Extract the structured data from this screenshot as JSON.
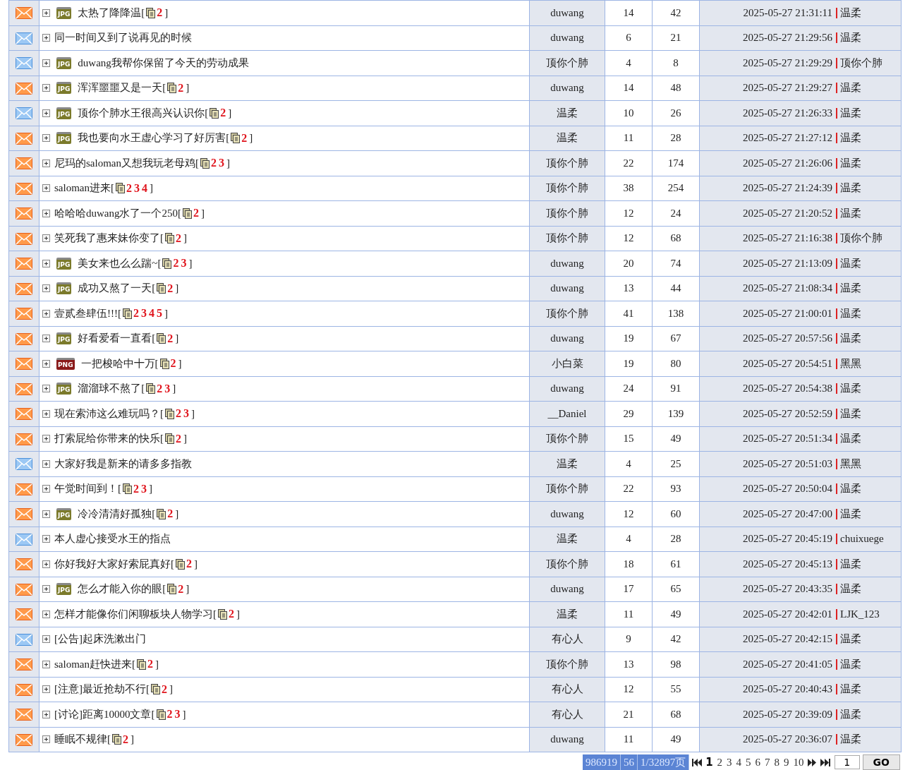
{
  "topics": [
    {
      "hot": true,
      "file": {
        "label": "JPG",
        "color": "#7b7a2a"
      },
      "title": "太热了降降温",
      "pages": {
        "open": "[",
        "links": [
          "2"
        ],
        "close": "]"
      },
      "author": "duwang",
      "replies": "14",
      "views": "42",
      "last_time": "2025-05-27 21:31:11",
      "last_user": "温柔"
    },
    {
      "hot": false,
      "title": "同一时间又到了说再见的时候",
      "author": "duwang",
      "replies": "6",
      "views": "21",
      "last_time": "2025-05-27 21:29:56",
      "last_user": "温柔"
    },
    {
      "hot": false,
      "file": {
        "label": "JPG",
        "color": "#7b7a2a"
      },
      "title": "duwang我帮你保留了今天的劳动成果",
      "author": "顶你个肺",
      "replies": "4",
      "views": "8",
      "last_time": "2025-05-27 21:29:29",
      "last_user": "顶你个肺"
    },
    {
      "hot": true,
      "file": {
        "label": "JPG",
        "color": "#7b7a2a"
      },
      "title": "浑浑噩噩又是一天",
      "pages": {
        "open": "[",
        "links": [
          "2"
        ],
        "close": "]"
      },
      "author": "duwang",
      "replies": "14",
      "views": "48",
      "last_time": "2025-05-27 21:29:27",
      "last_user": "温柔"
    },
    {
      "hot": false,
      "file": {
        "label": "JPG",
        "color": "#7b7a2a"
      },
      "title": "顶你个肺水王很高兴认识你",
      "pages": {
        "open": "[",
        "links": [
          "2"
        ],
        "close": "]"
      },
      "author": "温柔",
      "replies": "10",
      "views": "26",
      "last_time": "2025-05-27 21:26:33",
      "last_user": "温柔"
    },
    {
      "hot": true,
      "file": {
        "label": "JPG",
        "color": "#7b7a2a"
      },
      "title": "我也要向水王虚心学习了好厉害",
      "pages": {
        "open": "[",
        "links": [
          "2"
        ],
        "close": "]"
      },
      "author": "温柔",
      "replies": "11",
      "views": "28",
      "last_time": "2025-05-27 21:27:12",
      "last_user": "温柔"
    },
    {
      "hot": true,
      "title": "尼玛的saloman又想我玩老母鸡",
      "pages": {
        "open": "[",
        "links": [
          "2",
          "3"
        ],
        "close": "]"
      },
      "author": "顶你个肺",
      "replies": "22",
      "views": "174",
      "last_time": "2025-05-27 21:26:06",
      "last_user": "温柔"
    },
    {
      "hot": true,
      "title": "saloman进来",
      "pages": {
        "open": "[",
        "links": [
          "2",
          "3",
          "4"
        ],
        "close": "]"
      },
      "author": "顶你个肺",
      "replies": "38",
      "views": "254",
      "last_time": "2025-05-27 21:24:39",
      "last_user": "温柔"
    },
    {
      "hot": true,
      "title": "哈哈哈duwang水了一个250",
      "pages": {
        "open": "[",
        "links": [
          "2"
        ],
        "close": "]"
      },
      "author": "顶你个肺",
      "replies": "12",
      "views": "24",
      "last_time": "2025-05-27 21:20:52",
      "last_user": "温柔"
    },
    {
      "hot": true,
      "title": "笑死我了惠来妹你变了",
      "pages": {
        "open": "[",
        "links": [
          "2"
        ],
        "close": "]"
      },
      "author": "顶你个肺",
      "replies": "12",
      "views": "68",
      "last_time": "2025-05-27 21:16:38",
      "last_user": "顶你个肺"
    },
    {
      "hot": true,
      "file": {
        "label": "JPG",
        "color": "#7b7a2a"
      },
      "title": "美女来也么么踹~",
      "pages": {
        "open": "[",
        "links": [
          "2",
          "3"
        ],
        "close": "]"
      },
      "author": "duwang",
      "replies": "20",
      "views": "74",
      "last_time": "2025-05-27 21:13:09",
      "last_user": "温柔"
    },
    {
      "hot": true,
      "file": {
        "label": "JPG",
        "color": "#7b7a2a"
      },
      "title": "成功又熬了一天",
      "pages": {
        "open": "[",
        "links": [
          "2"
        ],
        "close": "]"
      },
      "author": "duwang",
      "replies": "13",
      "views": "44",
      "last_time": "2025-05-27 21:08:34",
      "last_user": "温柔"
    },
    {
      "hot": true,
      "title": "壹贰叁肆伍!!!",
      "pages": {
        "open": "[",
        "links": [
          "2",
          "3",
          "4",
          "5"
        ],
        "close": "]"
      },
      "author": "顶你个肺",
      "replies": "41",
      "views": "138",
      "last_time": "2025-05-27 21:00:01",
      "last_user": "温柔"
    },
    {
      "hot": true,
      "file": {
        "label": "JPG",
        "color": "#7b7a2a"
      },
      "title": "好看爱看一直看",
      "pages": {
        "open": "[",
        "links": [
          "2"
        ],
        "close": "]"
      },
      "author": "duwang",
      "replies": "19",
      "views": "67",
      "last_time": "2025-05-27 20:57:56",
      "last_user": "温柔"
    },
    {
      "hot": true,
      "file": {
        "label": "PNG",
        "color": "#8a1a1a"
      },
      "title": "一把梭哈中十万",
      "pages": {
        "open": "[",
        "links": [
          "2"
        ],
        "close": "]"
      },
      "author": "小白菜",
      "replies": "19",
      "views": "80",
      "last_time": "2025-05-27 20:54:51",
      "last_user": "黑黑"
    },
    {
      "hot": true,
      "file": {
        "label": "JPG",
        "color": "#7b7a2a"
      },
      "title": "溜溜球不熬了",
      "pages": {
        "open": "[",
        "links": [
          "2",
          "3"
        ],
        "close": "]"
      },
      "author": "duwang",
      "replies": "24",
      "views": "91",
      "last_time": "2025-05-27 20:54:38",
      "last_user": "温柔"
    },
    {
      "hot": true,
      "title": "现在索沛这么难玩吗？",
      "pages": {
        "open": "[",
        "links": [
          "2",
          "3"
        ],
        "close": "]"
      },
      "author": "__Daniel",
      "replies": "29",
      "views": "139",
      "last_time": "2025-05-27 20:52:59",
      "last_user": "温柔"
    },
    {
      "hot": true,
      "title": "打索屁给你带来的快乐",
      "pages": {
        "open": "[",
        "links": [
          "2"
        ],
        "close": "]"
      },
      "author": "顶你个肺",
      "replies": "15",
      "views": "49",
      "last_time": "2025-05-27 20:51:34",
      "last_user": "温柔"
    },
    {
      "hot": false,
      "title": "大家好我是新来的请多多指教",
      "author": "温柔",
      "replies": "4",
      "views": "25",
      "last_time": "2025-05-27 20:51:03",
      "last_user": "黑黑"
    },
    {
      "hot": true,
      "title": "午觉时间到！",
      "pages": {
        "open": "[",
        "links": [
          "2",
          "3"
        ],
        "close": "]"
      },
      "author": "顶你个肺",
      "replies": "22",
      "views": "93",
      "last_time": "2025-05-27 20:50:04",
      "last_user": "温柔"
    },
    {
      "hot": true,
      "file": {
        "label": "JPG",
        "color": "#7b7a2a"
      },
      "title": "冷冷清清好孤独",
      "pages": {
        "open": "[",
        "links": [
          "2"
        ],
        "close": "]"
      },
      "author": "duwang",
      "replies": "12",
      "views": "60",
      "last_time": "2025-05-27 20:47:00",
      "last_user": "温柔"
    },
    {
      "hot": false,
      "title": "本人虚心接受水王的指点",
      "author": "温柔",
      "replies": "4",
      "views": "28",
      "last_time": "2025-05-27 20:45:19",
      "last_user": "chuixuege"
    },
    {
      "hot": true,
      "title": "你好我好大家好索屁真好",
      "pages": {
        "open": "[",
        "links": [
          "2"
        ],
        "close": "]"
      },
      "author": "顶你个肺",
      "replies": "18",
      "views": "61",
      "last_time": "2025-05-27 20:45:13",
      "last_user": "温柔"
    },
    {
      "hot": true,
      "file": {
        "label": "JPG",
        "color": "#7b7a2a"
      },
      "title": "怎么才能入你的眼",
      "pages": {
        "open": "[",
        "links": [
          "2"
        ],
        "close": "]"
      },
      "author": "duwang",
      "replies": "17",
      "views": "65",
      "last_time": "2025-05-27 20:43:35",
      "last_user": "温柔"
    },
    {
      "hot": true,
      "title": "怎样才能像你们闲聊板块人物学习",
      "pages": {
        "open": "[",
        "links": [
          "2"
        ],
        "close": "]"
      },
      "author": "温柔",
      "replies": "11",
      "views": "49",
      "last_time": "2025-05-27 20:42:01",
      "last_user": "LJK_123"
    },
    {
      "hot": false,
      "title": "[公告]起床洗漱出门",
      "author": "有心人",
      "replies": "9",
      "views": "42",
      "last_time": "2025-05-27 20:42:15",
      "last_user": "温柔"
    },
    {
      "hot": true,
      "title": "saloman赶快进来",
      "pages": {
        "open": "[",
        "links": [
          "2"
        ],
        "close": "]"
      },
      "author": "顶你个肺",
      "replies": "13",
      "views": "98",
      "last_time": "2025-05-27 20:41:05",
      "last_user": "温柔"
    },
    {
      "hot": true,
      "title": "[注意]最近抢劫不行",
      "pages": {
        "open": "[",
        "links": [
          "2"
        ],
        "close": "]"
      },
      "author": "有心人",
      "replies": "12",
      "views": "55",
      "last_time": "2025-05-27 20:40:43",
      "last_user": "温柔"
    },
    {
      "hot": true,
      "title": "[讨论]距离10000文章",
      "pages": {
        "open": "[",
        "links": [
          "2",
          "3"
        ],
        "close": "]"
      },
      "author": "有心人",
      "replies": "21",
      "views": "68",
      "last_time": "2025-05-27 20:39:09",
      "last_user": "温柔"
    },
    {
      "hot": true,
      "title": "睡眠不规律",
      "pages": {
        "open": "[",
        "links": [
          "2"
        ],
        "close": "]"
      },
      "author": "duwang",
      "replies": "11",
      "views": "49",
      "last_time": "2025-05-27 20:36:07",
      "last_user": "温柔"
    }
  ],
  "pagination": {
    "stats": [
      "986919",
      "56",
      "1/32897页"
    ],
    "pages": [
      {
        "label": "1",
        "selected": true
      },
      {
        "label": "2",
        "selected": false
      },
      {
        "label": "3",
        "selected": false
      },
      {
        "label": "4",
        "selected": false
      },
      {
        "label": "5",
        "selected": false
      },
      {
        "label": "6",
        "selected": false
      },
      {
        "label": "7",
        "selected": false
      },
      {
        "label": "8",
        "selected": false
      },
      {
        "label": "9",
        "selected": false
      },
      {
        "label": "10",
        "selected": false
      }
    ],
    "jump_value": "1",
    "go": "GO"
  }
}
